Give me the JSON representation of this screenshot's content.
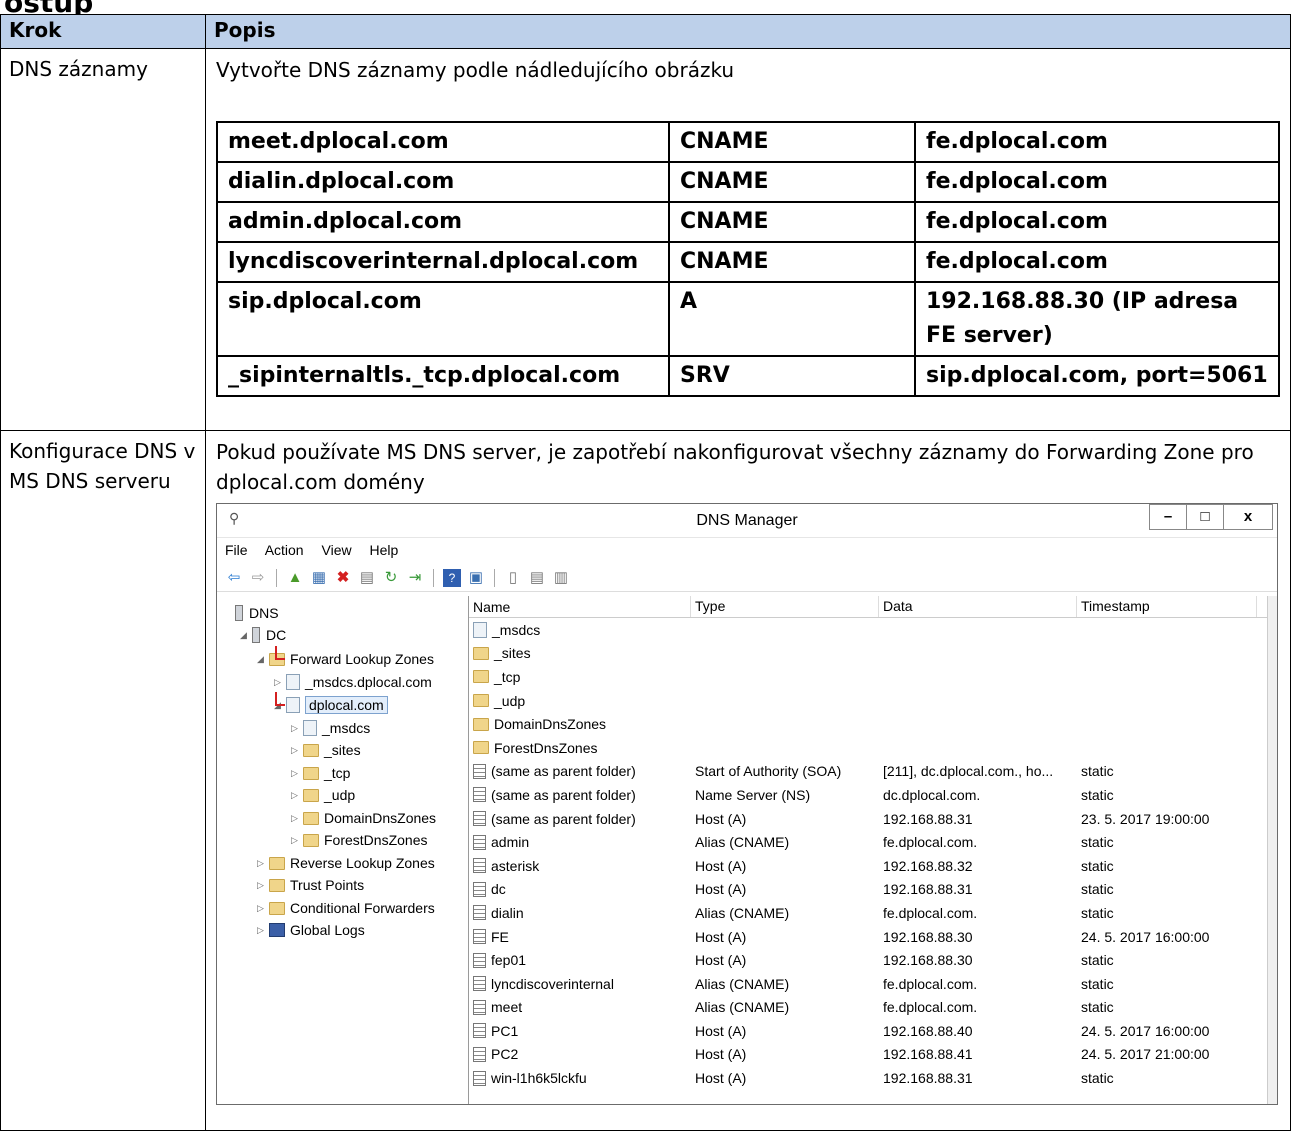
{
  "heading_fragment": "ostup",
  "table": {
    "col1": "Krok",
    "col2": "Popis",
    "row1": {
      "step": "DNS záznamy",
      "desc": "Vytvořte DNS záznamy podle nádledujícího obrázku",
      "records": [
        {
          "name": "meet.dplocal.com",
          "type": "CNAME",
          "value": "fe.dplocal.com"
        },
        {
          "name": "dialin.dplocal.com",
          "type": "CNAME",
          "value": "fe.dplocal.com"
        },
        {
          "name": "admin.dplocal.com",
          "type": "CNAME",
          "value": "fe.dplocal.com"
        },
        {
          "name": "lyncdiscoverinternal.dplocal.com",
          "type": "CNAME",
          "value": "fe.dplocal.com"
        },
        {
          "name": "sip.dplocal.com",
          "type": "A",
          "value": "192.168.88.30 (IP adresa FE server)"
        },
        {
          "name": "_sipinternaltls._tcp.dplocal.com",
          "type": "SRV",
          "value": "sip.dplocal.com, port=5061"
        }
      ]
    },
    "row2": {
      "step": "Konfigurace DNS v MS DNS serveru",
      "desc": "Pokud používate MS DNS server, je zapotřebí nakonfigurovat všechny záznamy do Forwarding Zone pro dplocal.com domény"
    }
  },
  "window": {
    "title": "DNS Manager",
    "minimize": "–",
    "maximize": "□",
    "close": "x",
    "menu": [
      "File",
      "Action",
      "View",
      "Help"
    ],
    "tree": [
      {
        "label": "DNS",
        "icon": "dns-root-icon",
        "indent": 0
      },
      {
        "label": "DC",
        "icon": "server-icon",
        "indent": 1
      },
      {
        "label": "Forward Lookup Zones",
        "icon": "folder-icon",
        "indent": 2
      },
      {
        "label": "_msdcs.dplocal.com",
        "icon": "zone-icon",
        "indent": 3
      },
      {
        "label": "dplocal.com",
        "icon": "zone-icon",
        "indent": 3
      },
      {
        "label": "_msdcs",
        "icon": "zone-icon",
        "indent": 4
      },
      {
        "label": "_sites",
        "icon": "folder-icon",
        "indent": 4
      },
      {
        "label": "_tcp",
        "icon": "folder-icon",
        "indent": 4
      },
      {
        "label": "_udp",
        "icon": "folder-icon",
        "indent": 4
      },
      {
        "label": "DomainDnsZones",
        "icon": "folder-icon",
        "indent": 4
      },
      {
        "label": "ForestDnsZones",
        "icon": "folder-icon",
        "indent": 4
      },
      {
        "label": "Reverse Lookup Zones",
        "icon": "folder-icon",
        "indent": 2
      },
      {
        "label": "Trust Points",
        "icon": "folder-icon",
        "indent": 2
      },
      {
        "label": "Conditional Forwarders",
        "icon": "folder-icon",
        "indent": 2
      },
      {
        "label": "Global Logs",
        "icon": "log-icon",
        "indent": 2
      }
    ],
    "columns": [
      "Name",
      "Type",
      "Data",
      "Timestamp"
    ],
    "rows": [
      {
        "name": "_msdcs",
        "type": "",
        "data": "",
        "ts": "",
        "icon": "zone"
      },
      {
        "name": "_sites",
        "type": "",
        "data": "",
        "ts": "",
        "icon": "folder"
      },
      {
        "name": "_tcp",
        "type": "",
        "data": "",
        "ts": "",
        "icon": "folder"
      },
      {
        "name": "_udp",
        "type": "",
        "data": "",
        "ts": "",
        "icon": "folder"
      },
      {
        "name": "DomainDnsZones",
        "type": "",
        "data": "",
        "ts": "",
        "icon": "folder"
      },
      {
        "name": "ForestDnsZones",
        "type": "",
        "data": "",
        "ts": "",
        "icon": "folder"
      },
      {
        "name": "(same as parent folder)",
        "type": "Start of Authority (SOA)",
        "data": "[211], dc.dplocal.com., ho...",
        "ts": "static",
        "icon": "record"
      },
      {
        "name": "(same as parent folder)",
        "type": "Name Server (NS)",
        "data": "dc.dplocal.com.",
        "ts": "static",
        "icon": "record"
      },
      {
        "name": "(same as parent folder)",
        "type": "Host (A)",
        "data": "192.168.88.31",
        "ts": "23. 5. 2017 19:00:00",
        "icon": "record"
      },
      {
        "name": "admin",
        "type": "Alias (CNAME)",
        "data": "fe.dplocal.com.",
        "ts": "static",
        "icon": "record"
      },
      {
        "name": "asterisk",
        "type": "Host (A)",
        "data": "192.168.88.32",
        "ts": "static",
        "icon": "record"
      },
      {
        "name": "dc",
        "type": "Host (A)",
        "data": "192.168.88.31",
        "ts": "static",
        "icon": "record"
      },
      {
        "name": "dialin",
        "type": "Alias (CNAME)",
        "data": "fe.dplocal.com.",
        "ts": "static",
        "icon": "record"
      },
      {
        "name": "FE",
        "type": "Host (A)",
        "data": "192.168.88.30",
        "ts": "24. 5. 2017 16:00:00",
        "icon": "record"
      },
      {
        "name": "fep01",
        "type": "Host (A)",
        "data": "192.168.88.30",
        "ts": "static",
        "icon": "record"
      },
      {
        "name": "lyncdiscoverinternal",
        "type": "Alias (CNAME)",
        "data": "fe.dplocal.com.",
        "ts": "static",
        "icon": "record"
      },
      {
        "name": "meet",
        "type": "Alias (CNAME)",
        "data": "fe.dplocal.com.",
        "ts": "static",
        "icon": "record"
      },
      {
        "name": "PC1",
        "type": "Host (A)",
        "data": "192.168.88.40",
        "ts": "24. 5. 2017 16:00:00",
        "icon": "record"
      },
      {
        "name": "PC2",
        "type": "Host (A)",
        "data": "192.168.88.41",
        "ts": "24. 5. 2017 21:00:00",
        "icon": "record"
      },
      {
        "name": "win-l1h6k5lckfu",
        "type": "Host (A)",
        "data": "192.168.88.31",
        "ts": "static",
        "icon": "record"
      }
    ]
  }
}
